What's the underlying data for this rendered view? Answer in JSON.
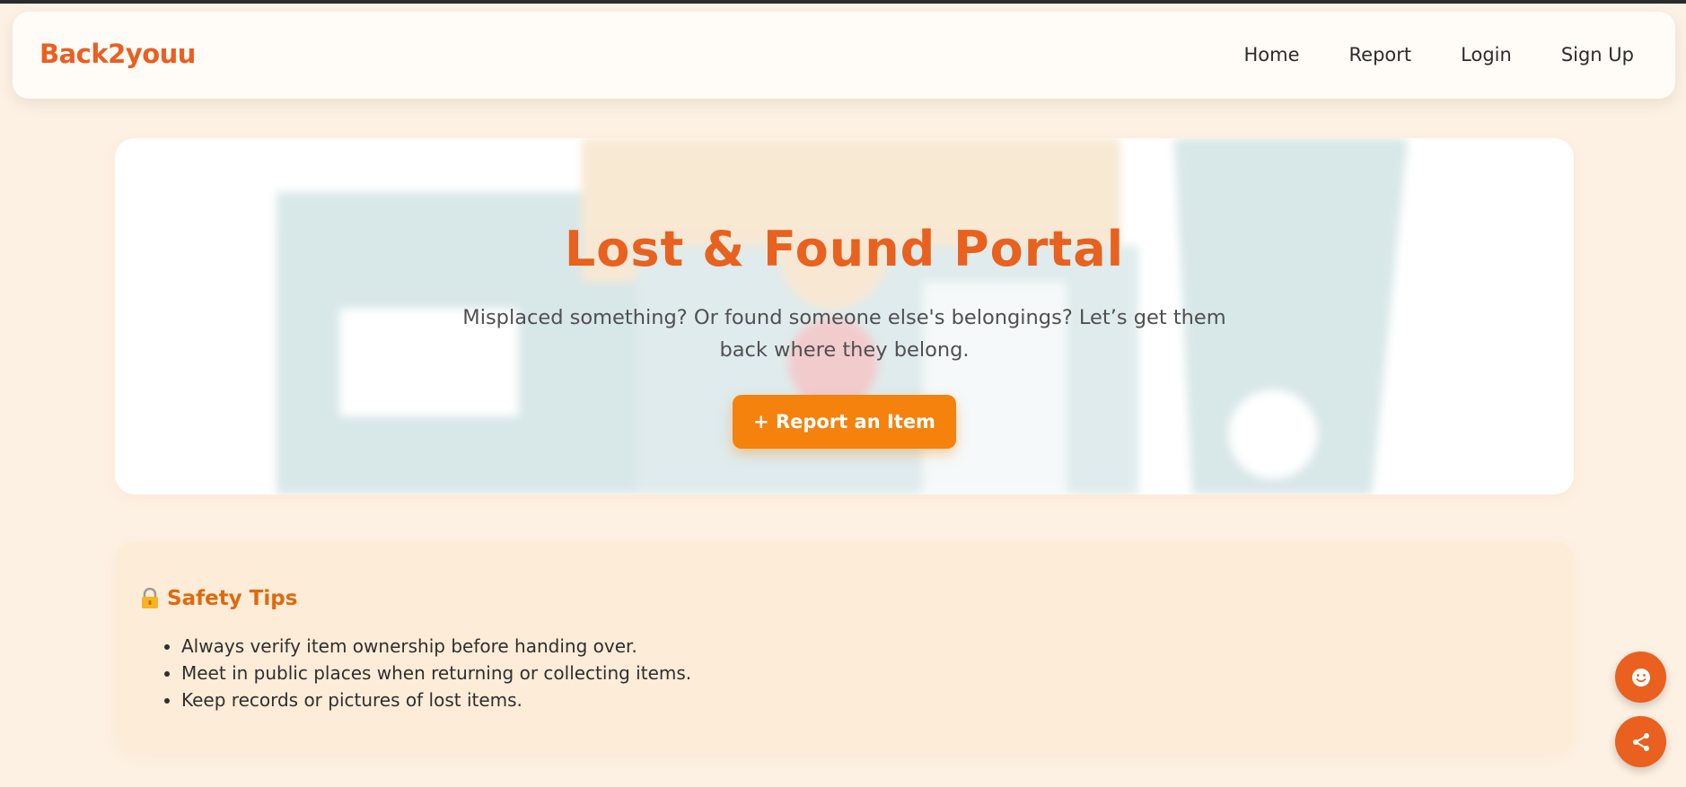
{
  "brand": "Back2youu",
  "nav": {
    "home": "Home",
    "report": "Report",
    "login": "Login",
    "signup": "Sign Up"
  },
  "hero": {
    "title": "Lost & Found Portal",
    "subtitle": "Misplaced something? Or found someone else's belongings? Let’s get them back where they belong.",
    "button_label": "+ Report an Item"
  },
  "safety": {
    "heading": "Safety Tips",
    "icon": "lock-icon",
    "items": [
      "Always verify item ownership before handing over.",
      "Meet in public places when returning or collecting items.",
      "Keep records or pictures of lost items."
    ]
  },
  "floating_buttons": [
    {
      "icon": "smiley-icon"
    },
    {
      "icon": "share-icon"
    }
  ],
  "colors": {
    "brand": "#ea5f22",
    "button": "#f4820c",
    "background": "#fdf1e3",
    "tips_bg": "#fdecd8"
  }
}
